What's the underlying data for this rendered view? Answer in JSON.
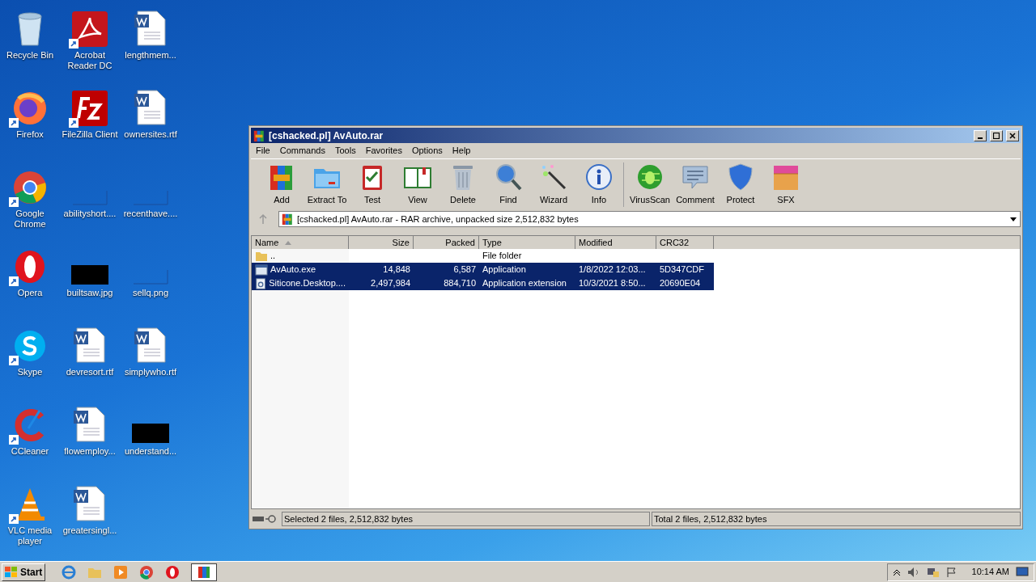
{
  "desktop_icons": [
    {
      "label": "Recycle Bin",
      "kind": "recycle",
      "shortcut": false
    },
    {
      "label": "Acrobat Reader DC",
      "kind": "acrobat",
      "shortcut": true
    },
    {
      "label": "lengthmem...",
      "kind": "document",
      "shortcut": false
    },
    {
      "label": "Firefox",
      "kind": "firefox",
      "shortcut": true
    },
    {
      "label": "FileZilla Client",
      "kind": "filezilla",
      "shortcut": true
    },
    {
      "label": "ownersites.rtf",
      "kind": "document",
      "shortcut": false
    },
    {
      "label": "Google Chrome",
      "kind": "chrome",
      "shortcut": true
    },
    {
      "label": "abilityshort....",
      "kind": "blank",
      "shortcut": false
    },
    {
      "label": "recenthave....",
      "kind": "blank",
      "shortcut": false
    },
    {
      "label": "Opera",
      "kind": "opera",
      "shortcut": true
    },
    {
      "label": "builtsaw.jpg",
      "kind": "black",
      "shortcut": false
    },
    {
      "label": "sellq.png",
      "kind": "blank",
      "shortcut": false
    },
    {
      "label": "Skype",
      "kind": "skype",
      "shortcut": true
    },
    {
      "label": "devresort.rtf",
      "kind": "document",
      "shortcut": false
    },
    {
      "label": "simplywho.rtf",
      "kind": "document",
      "shortcut": false
    },
    {
      "label": "CCleaner",
      "kind": "ccleaner",
      "shortcut": true
    },
    {
      "label": "flowemploy...",
      "kind": "document",
      "shortcut": false
    },
    {
      "label": "understand...",
      "kind": "black",
      "shortcut": false
    },
    {
      "label": "VLC media player",
      "kind": "vlc",
      "shortcut": true
    },
    {
      "label": "greatersingl...",
      "kind": "document",
      "shortcut": false
    }
  ],
  "window": {
    "title": "[cshacked.pl] AvAuto.rar",
    "menu": [
      "File",
      "Commands",
      "Tools",
      "Favorites",
      "Options",
      "Help"
    ],
    "toolbar": [
      {
        "label": "Add",
        "kind": "add"
      },
      {
        "label": "Extract To",
        "kind": "extract"
      },
      {
        "label": "Test",
        "kind": "test"
      },
      {
        "label": "View",
        "kind": "view"
      },
      {
        "label": "Delete",
        "kind": "delete"
      },
      {
        "label": "Find",
        "kind": "find"
      },
      {
        "label": "Wizard",
        "kind": "wizard"
      },
      {
        "label": "Info",
        "kind": "info"
      },
      {
        "label": "VirusScan",
        "kind": "virus"
      },
      {
        "label": "Comment",
        "kind": "comment"
      },
      {
        "label": "Protect",
        "kind": "protect"
      },
      {
        "label": "SFX",
        "kind": "sfx"
      }
    ],
    "path": "[cshacked.pl] AvAuto.rar - RAR archive, unpacked size 2,512,832 bytes",
    "table": {
      "columns": [
        "Name",
        "Size",
        "Packed",
        "Type",
        "Modified",
        "CRC32"
      ],
      "rows": [
        {
          "kind": "folder",
          "cells": [
            "..",
            "",
            "",
            "File folder",
            "",
            ""
          ],
          "selected": false
        },
        {
          "kind": "exe",
          "cells": [
            "AvAuto.exe",
            "14,848",
            "6,587",
            "Application",
            "1/8/2022 12:03...",
            "5D347CDF"
          ],
          "selected": true
        },
        {
          "kind": "dll",
          "cells": [
            "Siticone.Desktop....",
            "2,497,984",
            "884,710",
            "Application extension",
            "10/3/2021 8:50...",
            "20690E04"
          ],
          "selected": true
        }
      ]
    },
    "status_left": "Selected 2 files, 2,512,832 bytes",
    "status_right": "Total 2 files, 2,512,832 bytes"
  },
  "taskbar": {
    "start": "Start",
    "clock": "10:14 AM"
  }
}
